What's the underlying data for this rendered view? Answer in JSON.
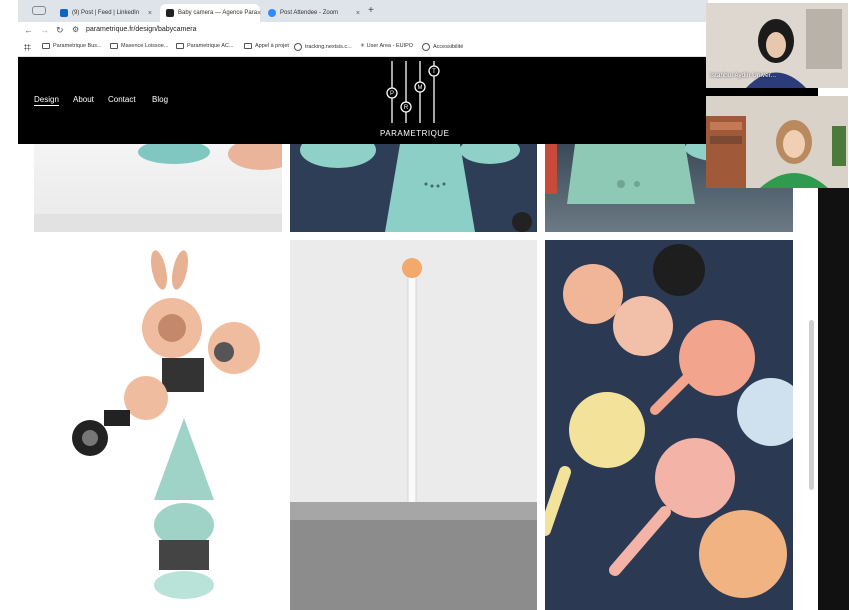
{
  "browser": {
    "tabs": [
      {
        "label": "(9) Post | Feed | LinkedIn",
        "icon": "linkedin-icon",
        "color": "#0a66c2"
      },
      {
        "label": "Baby camera — Agence Para",
        "icon": "site-icon",
        "color": "#222222",
        "active": true
      },
      {
        "label": "Post Attendee - Zoom",
        "icon": "zoom-icon",
        "color": "#2d8cff"
      }
    ],
    "close_glyph": "×",
    "new_tab_glyph": "+",
    "url": "parametrique.fr/design/babycamera",
    "bookmarks": [
      {
        "label": "Parametrique Bus..."
      },
      {
        "label": "Maxence Loissoe..."
      },
      {
        "label": "Parametrique AC..."
      },
      {
        "label": "Appel à projet"
      },
      {
        "label": "tracking.nextsis.c..."
      },
      {
        "label": "User Area - EUIPO"
      },
      {
        "label": "Accessibilité"
      }
    ]
  },
  "site": {
    "nav": [
      "Design",
      "About",
      "Contact",
      "Blog"
    ],
    "active_nav": "Design",
    "logo_letters": [
      "P",
      "R",
      "M",
      "T"
    ],
    "logo_text": "PARAMETRIQUE",
    "colors": {
      "header": "#000000",
      "product_teal": "#8fd1c9",
      "product_peach": "#f0b18f",
      "backdrop_navy": "#2b3a52"
    }
  },
  "video": {
    "participant_1": "Istanbul Aydin Univer..."
  }
}
